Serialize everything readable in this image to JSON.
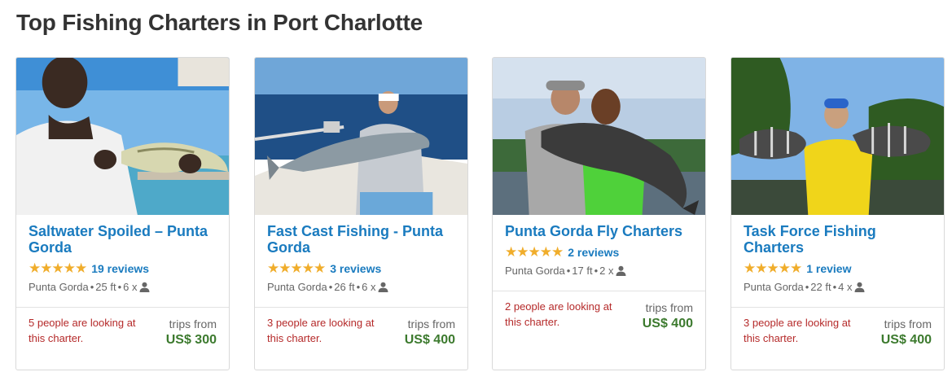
{
  "page": {
    "title": "Top Fishing Charters in Port Charlotte"
  },
  "colors": {
    "link": "#1a7bbf",
    "star": "#f0ad2b",
    "looking": "#b52a2a",
    "price": "#3c7a2e"
  },
  "icons": {
    "stars": "star-icon",
    "capacity": "person-icon"
  },
  "cards": [
    {
      "name": "Saltwater Spoiled – Punta Gorda",
      "stars": "★★★★★",
      "rating": 5,
      "reviews": "19 reviews",
      "location": "Punta Gorda",
      "length": "25 ft",
      "capacity": "6 x",
      "looking": "5 people are looking at this charter.",
      "trips_from": "trips from",
      "price": "US$ 300"
    },
    {
      "name": "Fast Cast Fishing - Punta Gorda",
      "stars": "★★★★★",
      "rating": 5,
      "reviews": "3 reviews",
      "location": "Punta Gorda",
      "length": "26 ft",
      "capacity": "6 x",
      "looking": "3 people are looking at this charter.",
      "trips_from": "trips from",
      "price": "US$ 400"
    },
    {
      "name": "Punta Gorda Fly Charters",
      "stars": "★★★★★",
      "rating": 5,
      "reviews": "2 reviews",
      "location": "Punta Gorda",
      "length": "17 ft",
      "capacity": "2 x",
      "looking": "2 people are looking at this charter.",
      "trips_from": "trips from",
      "price": "US$ 400"
    },
    {
      "name": "Task Force Fishing Charters",
      "stars": "★★★★★",
      "rating": 5,
      "reviews": "1 review",
      "location": "Punta Gorda",
      "length": "22 ft",
      "capacity": "4 x",
      "looking": "3 people are looking at this charter.",
      "trips_from": "trips from",
      "price": "US$ 400"
    }
  ]
}
